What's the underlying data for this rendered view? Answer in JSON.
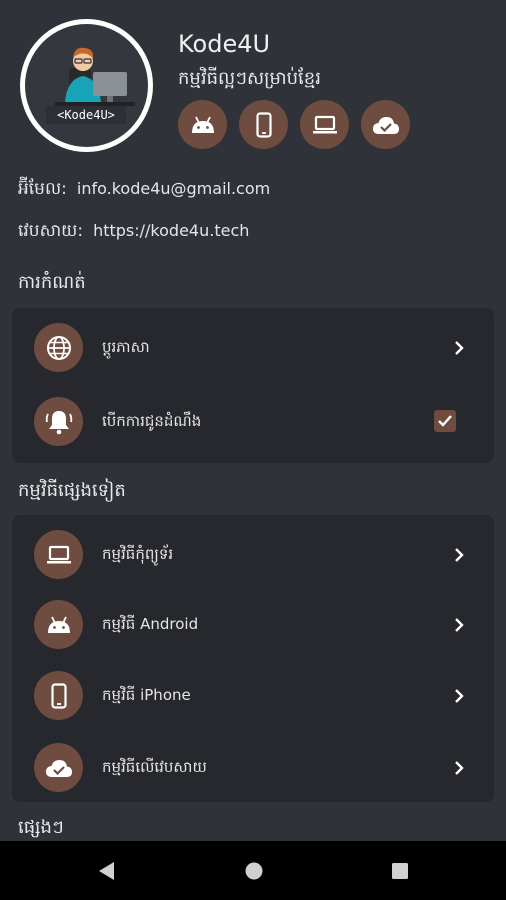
{
  "profile": {
    "logo_text": "<Kode4U>",
    "app_name": "Kode4U",
    "tagline": "កម្មវិធីល្អៗសម្រាប់ខ្មែរ",
    "platforms": [
      "android-icon",
      "phone-icon",
      "laptop-icon",
      "cloud-check-icon"
    ]
  },
  "contact": {
    "email_label": "អ៊ីមែល:",
    "email": "info.kode4u@gmail.com",
    "web_label": "វេបសាយ:",
    "web": "https://kode4u.tech"
  },
  "settings": {
    "title": "ការកំណត់",
    "items": [
      {
        "label": "ប្ដូរភាសា",
        "icon": "globe-icon",
        "control": "chevron"
      },
      {
        "label": "បើកការជូនដំណឹង",
        "icon": "bell-icon",
        "control": "checkbox",
        "checked": true
      }
    ]
  },
  "other_apps": {
    "title": "កម្មវិធីផ្សេងទៀត",
    "items": [
      {
        "label": "កម្មវិធីកុំព្យូទ័រ",
        "icon": "laptop-icon"
      },
      {
        "label": "កម្មវិធី Android",
        "icon": "android-icon"
      },
      {
        "label": "កម្មវិធី iPhone",
        "icon": "phone-icon"
      },
      {
        "label": "កម្មវិធីលើវេបសាយ",
        "icon": "cloud-check-icon"
      }
    ]
  },
  "misc": {
    "title": "ផ្សេងៗ"
  },
  "colors": {
    "background": "#2f3239",
    "card": "#26282d",
    "accent": "#6e4c3f"
  }
}
